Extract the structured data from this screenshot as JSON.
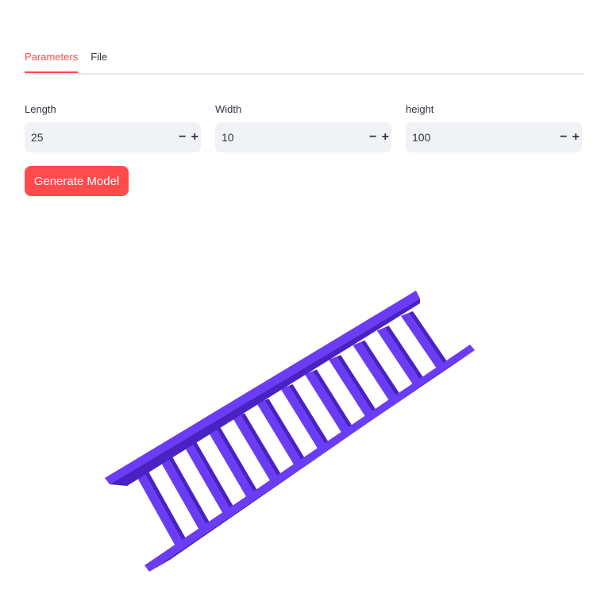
{
  "tabs": [
    {
      "label": "Parameters",
      "active": true
    },
    {
      "label": "File",
      "active": false
    }
  ],
  "fields": {
    "length": {
      "label": "Length",
      "value": "25"
    },
    "width": {
      "label": "Width",
      "value": "10"
    },
    "height": {
      "label": "height",
      "value": "100"
    }
  },
  "stepper": {
    "minus": "−",
    "plus": "+"
  },
  "generate_button": {
    "label": "Generate Model"
  },
  "colors": {
    "accent": "#ff4b4b",
    "model": "#6a3cf5",
    "model_dark": "#4a22c4",
    "input_bg": "#f0f2f6"
  },
  "icons": [
    "minus-icon",
    "plus-icon"
  ]
}
